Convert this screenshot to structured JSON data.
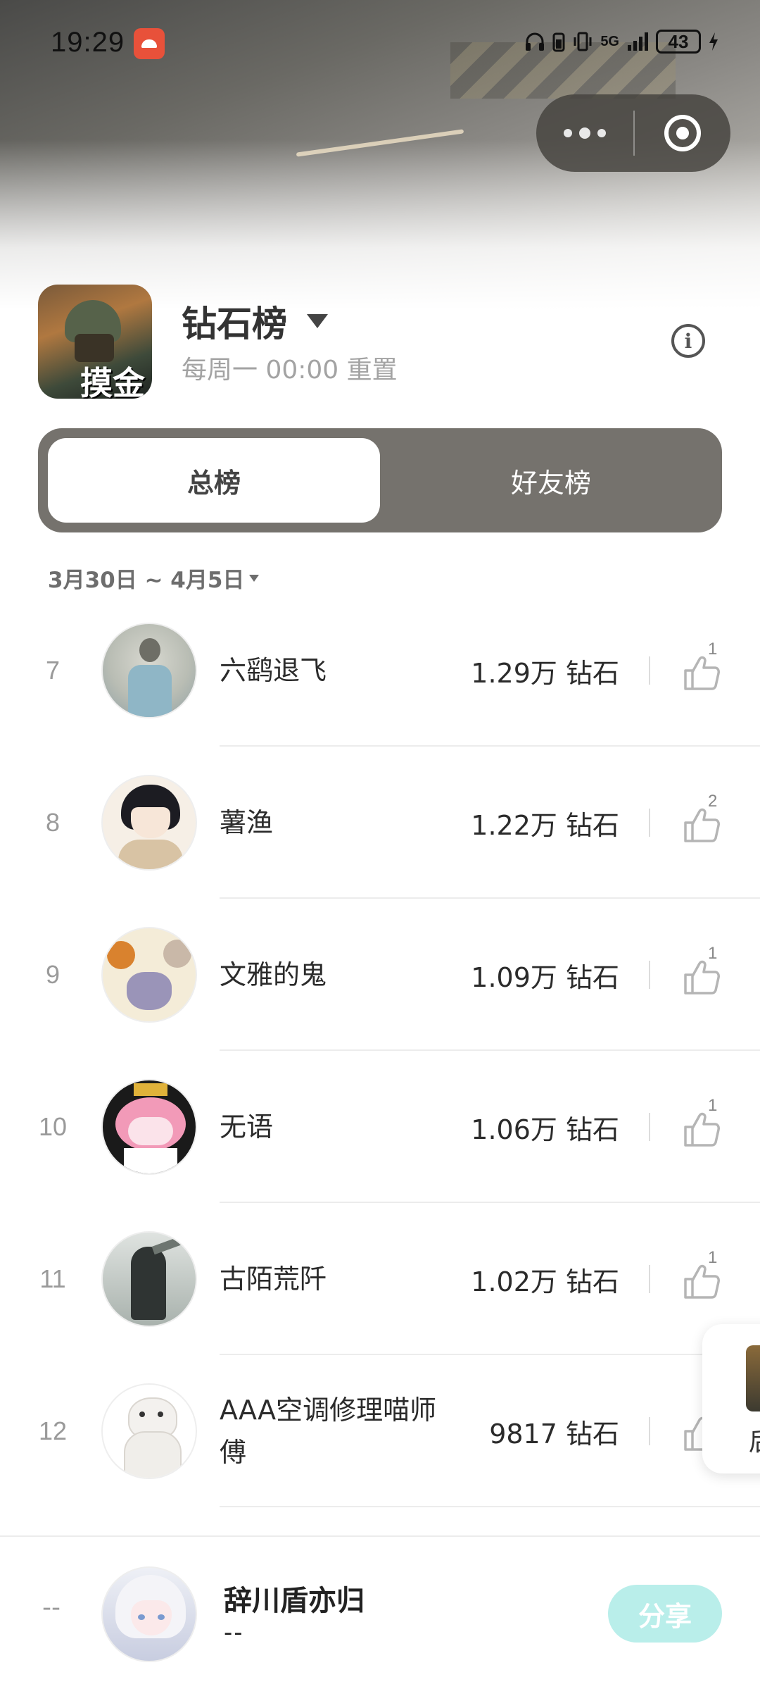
{
  "status_bar": {
    "time": "19:29",
    "network": "5G",
    "battery": "43"
  },
  "header": {
    "game_icon_text": "摸金",
    "board_title": "钻石榜",
    "reset_text": "每周一 00:00 重置"
  },
  "tabs": [
    {
      "label": "总榜",
      "active": true
    },
    {
      "label": "好友榜",
      "active": false
    }
  ],
  "date_range": "3月30日 ~ 4月5日",
  "rows": [
    {
      "rank": "7",
      "name": "六鹞退飞",
      "score": "1.29万 钻石",
      "likes": "1"
    },
    {
      "rank": "8",
      "name": "薯渔",
      "score": "1.22万 钻石",
      "likes": "2"
    },
    {
      "rank": "9",
      "name": "文雅的鬼",
      "score": "1.09万 钻石",
      "likes": "1"
    },
    {
      "rank": "10",
      "name": "无语",
      "score": "1.06万 钻石",
      "likes": "1"
    },
    {
      "rank": "11",
      "name": "古陌荒阡",
      "score": "1.02万 钻石",
      "likes": "1"
    },
    {
      "rank": "12",
      "name": "AAA空调修理喵师傅",
      "score": "9817 钻石",
      "likes": ""
    }
  ],
  "floating_card": {
    "label": "后"
  },
  "me": {
    "rank": "--",
    "name": "辞川盾亦归",
    "score": "--",
    "share_label": "分享"
  },
  "colors": {
    "tab_bg": "#75726d",
    "share_bg": "#b9eeea"
  }
}
